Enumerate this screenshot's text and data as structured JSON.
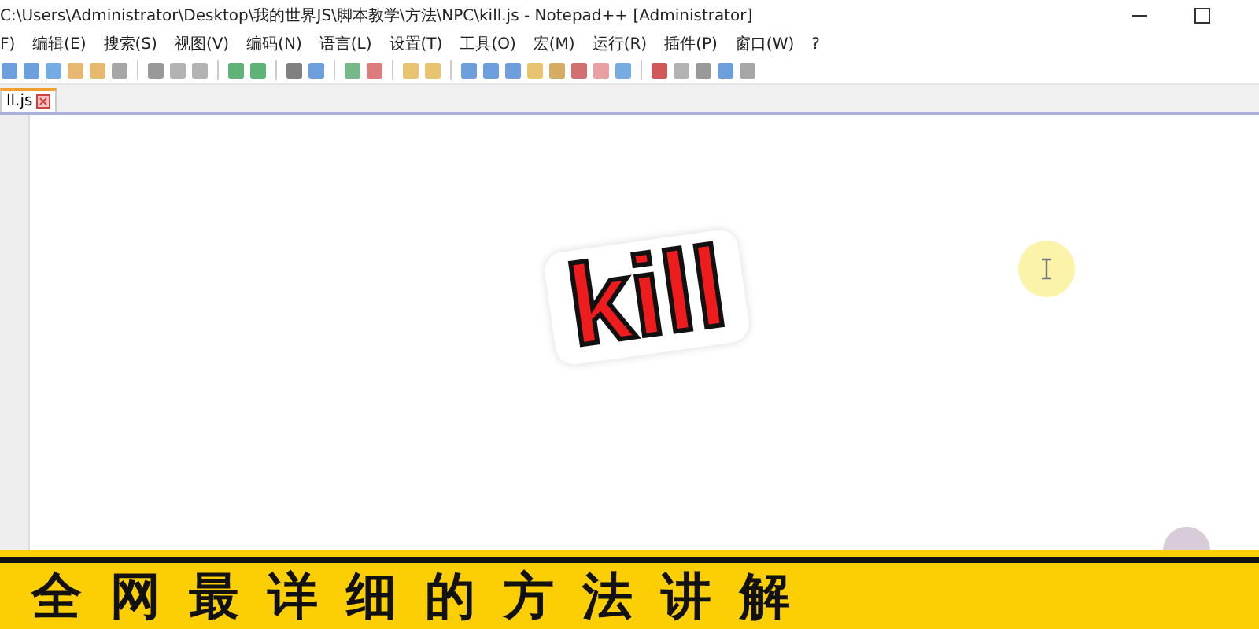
{
  "window": {
    "title": "C:\\Users\\Administrator\\Desktop\\我的世界JS\\脚本教学\\方法\\NPC\\kill.js - Notepad++ [Administrator]"
  },
  "menu": [
    "F)",
    "编辑(E)",
    "搜索(S)",
    "视图(V)",
    "编码(N)",
    "语言(L)",
    "设置(T)",
    "工具(O)",
    "宏(M)",
    "运行(R)",
    "插件(P)",
    "窗口(W)",
    "?"
  ],
  "tabs": [
    {
      "label": "ll.js",
      "selected": true
    }
  ],
  "sticker": {
    "text": "kill"
  },
  "banner": {
    "text": "全网最详细的方法讲解"
  }
}
